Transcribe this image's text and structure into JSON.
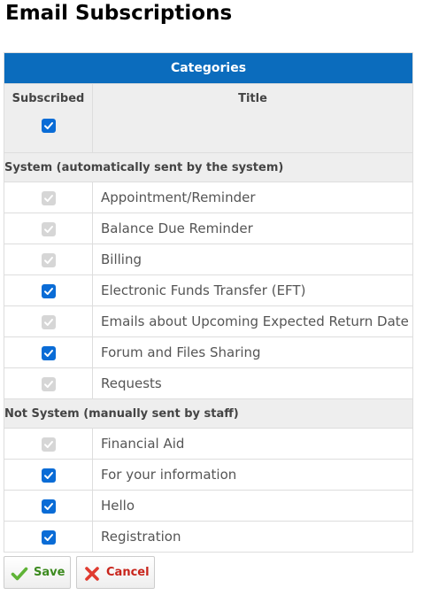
{
  "page": {
    "title": "Email Subscriptions"
  },
  "table": {
    "header": "Categories",
    "col_subscribed": "Subscribed",
    "col_title": "Title",
    "select_all_checked": true
  },
  "groups": [
    {
      "label": "System (automatically sent by the system)",
      "items": [
        {
          "title": "Appointment/Reminder",
          "checked": true,
          "disabled": true
        },
        {
          "title": "Balance Due Reminder",
          "checked": true,
          "disabled": true
        },
        {
          "title": "Billing",
          "checked": true,
          "disabled": true
        },
        {
          "title": "Electronic Funds Transfer (EFT)",
          "checked": true,
          "disabled": false
        },
        {
          "title": "Emails about Upcoming Expected Return Date",
          "checked": true,
          "disabled": true
        },
        {
          "title": "Forum and Files Sharing",
          "checked": true,
          "disabled": false
        },
        {
          "title": "Requests",
          "checked": true,
          "disabled": true
        }
      ]
    },
    {
      "label": "Not System (manually sent by staff)",
      "items": [
        {
          "title": "Financial Aid",
          "checked": true,
          "disabled": true
        },
        {
          "title": "For your information",
          "checked": true,
          "disabled": false
        },
        {
          "title": "Hello",
          "checked": true,
          "disabled": false
        },
        {
          "title": "Registration",
          "checked": true,
          "disabled": false
        }
      ]
    }
  ],
  "actions": {
    "save_label": "Save",
    "save_icon": "checkmark-icon",
    "cancel_label": "Cancel",
    "cancel_icon": "x-icon"
  },
  "colors": {
    "header_bg": "#0b6cbd",
    "checkbox_enabled": "#0a6cd6",
    "checkbox_disabled": "#d6d6d6",
    "save_color": "#3c8a1f",
    "cancel_color": "#c8241b"
  }
}
